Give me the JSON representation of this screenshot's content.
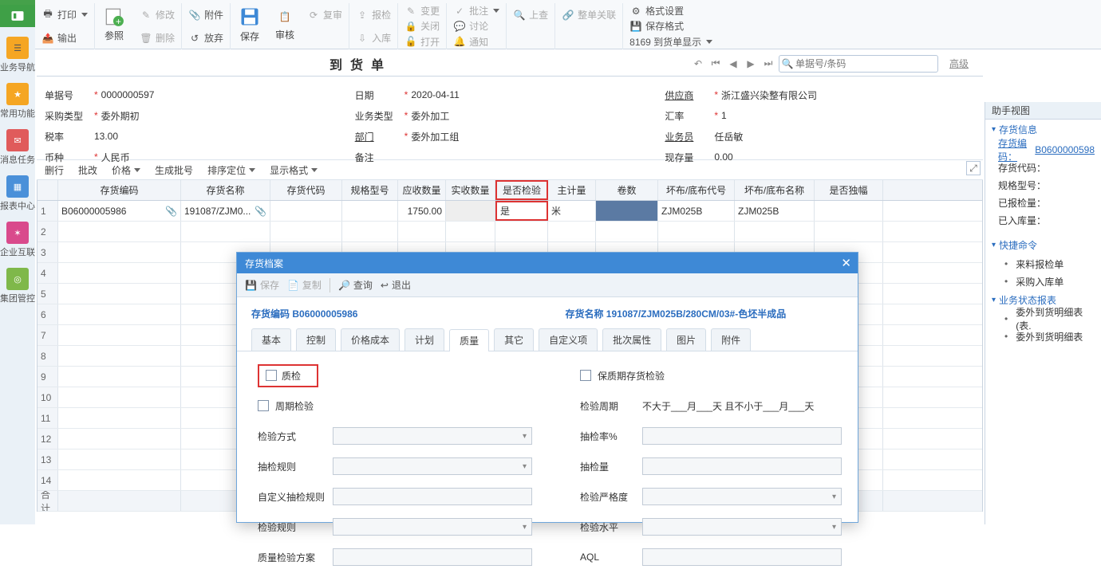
{
  "ribbon": {
    "print": "打印",
    "output": "输出",
    "reference": "参照",
    "modify": "修改",
    "delete": "删除",
    "attachment": "附件",
    "abandon": "放弃",
    "save": "保存",
    "audit": "审核",
    "review": "复审",
    "report": "报检",
    "inbound": "入库",
    "change": "变更",
    "close": "关闭",
    "open": "打开",
    "approve": "批注",
    "discuss": "讨论",
    "notify": "通知",
    "check_up": "上查",
    "whole_link": "整单关联",
    "format_set": "格式设置",
    "save_format": "保存格式",
    "display_mode": "8169 到货单显示",
    "format_dd": "▾"
  },
  "sidebar": {
    "nav": "业务导航",
    "freq": "常用功能",
    "msg": "消息任务",
    "report": "报表中心",
    "ent": "企业互联",
    "group": "集团管控"
  },
  "title": "到货单",
  "search_placeholder": "单据号/条码",
  "adv": "高级",
  "form": {
    "bill_no_l": "单据号",
    "bill_no": "0000000597",
    "date_l": "日期",
    "date": "2020-04-11",
    "supplier_l": "供应商",
    "supplier": "浙江盛兴染整有限公司",
    "ptype_l": "采购类型",
    "ptype": "委外期初",
    "btype_l": "业务类型",
    "btype": "委外加工",
    "rate_l": "汇率",
    "rate": "1",
    "tax_l": "税率",
    "tax": "13.00",
    "dept_l": "部门",
    "dept": "委外加工组",
    "sales_l": "业务员",
    "sales": "任岳敏",
    "curr_l": "币种",
    "curr": "人民币",
    "remark_l": "备注",
    "remark": "",
    "cash_l": "现存量",
    "cash": "0.00"
  },
  "tb_toolbar": {
    "delrow": "删行",
    "batch": "批改",
    "price": "价格",
    "genlot": "生成批号",
    "sort": "排序定位",
    "dispfmt": "显示格式"
  },
  "grid_headers": [
    "存货编码",
    "存货名称",
    "存货代码",
    "规格型号",
    "应收数量",
    "实收数量",
    "是否检验",
    "主计量",
    "卷数",
    "坏布/底布代号",
    "坏布/底布名称",
    "是否独幅"
  ],
  "grid_row": {
    "code": "B06000005986",
    "name": "191087/ZJM0...",
    "name_clip": "📎",
    "qty": "1750.00",
    "ischeck": "是",
    "unit": "米",
    "bad_code": "ZJM025B",
    "bad_name": "ZJM025B"
  },
  "sum_label": "合计",
  "assist": {
    "title": "助手视图",
    "sec1": "存货信息",
    "inv_code_l": "存货编码：",
    "inv_code": "B0600000598",
    "inv_proxy": "存货代码：",
    "spec": "规格型号：",
    "inspected": "已报检量：",
    "instock": "已入库量：",
    "sec2": "快捷命令",
    "link1": "来料报检单",
    "link2": "采购入库单",
    "sec3": "业务状态报表",
    "link3": "委外到货明细表(表.",
    "link4": "委外到货明细表"
  },
  "modal": {
    "title": "存货档案",
    "save": "保存",
    "copy": "复制",
    "query": "查询",
    "exit": "退出",
    "inv_code_l": "存货编码",
    "inv_code": "B06000005986",
    "inv_name_l": "存货名称",
    "inv_name": "191087/ZJM025B/280CM/03#-色坯半成品",
    "tabs": [
      "基本",
      "控制",
      "价格成本",
      "计划",
      "质量",
      "其它",
      "自定义项",
      "批次属性",
      "图片",
      "附件"
    ],
    "qc": "质检",
    "period": "周期检验",
    "warranty": "保质期存货检验",
    "cycle_l": "检验周期",
    "cycle_v": "不大于___月___天 且不小于___月___天",
    "insp_method": "检验方式",
    "sample_rule": "抽检规则",
    "cust_rule": "自定义抽检规则",
    "insp_rule": "检验规则",
    "qc_plan": "质量检验方案",
    "sample_pct": "抽检率%",
    "sample_qty": "抽检量",
    "severity": "检验严格度",
    "level": "检验水平",
    "aql": "AQL"
  }
}
